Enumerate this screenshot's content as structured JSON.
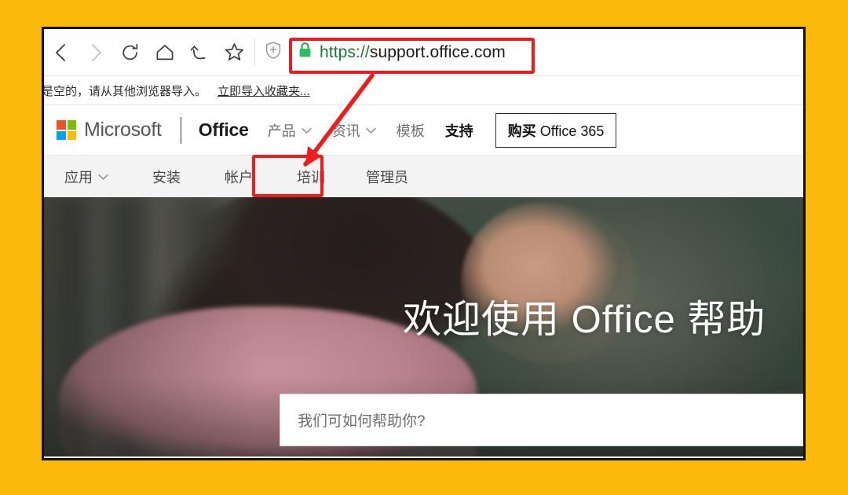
{
  "background_color": "#fcb80b",
  "annotation_color": "#ee1c1c",
  "browser": {
    "toolbar": {
      "back_icon": "back-arrow-icon",
      "forward_icon": "forward-arrow-icon",
      "refresh_icon": "refresh-icon",
      "home_icon": "home-icon",
      "history_icon": "undo-arrow-icon",
      "favorite_icon": "star-icon",
      "shield_icon": "shield-plus-icon"
    },
    "address_bar": {
      "lock_icon": "green-lock-icon",
      "scheme": "https",
      "separator": "://",
      "host": "support.office.com",
      "full_url": "https://support.office.com",
      "scheme_color": "#1a7a33"
    },
    "bookmarks_bar": {
      "hint": "夹是空的，请从其他浏览器导入。",
      "import_link": "立即导入收藏夹..."
    }
  },
  "header": {
    "logo": {
      "name": "microsoft-logo",
      "wordmark": "Microsoft",
      "colors": [
        "#f25022",
        "#7fba00",
        "#00a4ef",
        "#ffb900"
      ]
    },
    "product_title": "Office",
    "nav": [
      {
        "label": "产品",
        "has_chevron": true,
        "active": false
      },
      {
        "label": "资讯",
        "has_chevron": true,
        "active": false
      },
      {
        "label": "模板",
        "has_chevron": false,
        "active": false
      },
      {
        "label": "支持",
        "has_chevron": false,
        "active": true
      }
    ],
    "buy_button": {
      "cn": "购买",
      "en": " Office 365"
    }
  },
  "sub_nav": {
    "items": [
      {
        "label": "应用",
        "has_chevron": true,
        "highlighted": false
      },
      {
        "label": "安装",
        "has_chevron": false,
        "highlighted": false
      },
      {
        "label": "帐户",
        "has_chevron": false,
        "highlighted": false
      },
      {
        "label": "培训",
        "has_chevron": false,
        "highlighted": true
      },
      {
        "label": "管理员",
        "has_chevron": false,
        "highlighted": false
      }
    ]
  },
  "hero": {
    "heading": "欢迎使用 Office 帮助",
    "search_placeholder": "我们可如何帮助你?",
    "image_alt": "woman-working-photo"
  }
}
